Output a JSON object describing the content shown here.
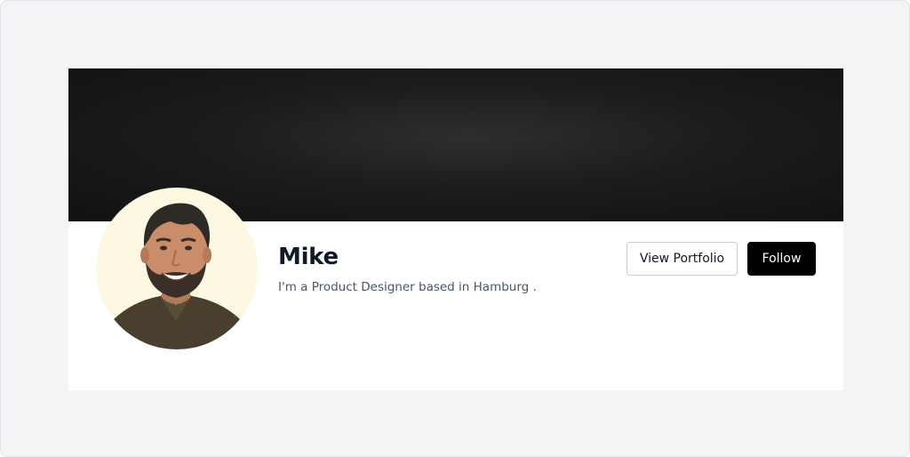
{
  "profile": {
    "name": "Mike",
    "bio": "I'm a Product Designer based in Hamburg ."
  },
  "actions": {
    "view_portfolio_label": "View Portfolio",
    "follow_label": "Follow"
  },
  "colors": {
    "page_background": "#f3f4f6",
    "cover": "#1c1c1c",
    "card": "#ffffff",
    "avatar_background": "#fdf8e2",
    "follow_button": "#000000",
    "name_text": "#111827",
    "bio_text": "#4b5563"
  }
}
